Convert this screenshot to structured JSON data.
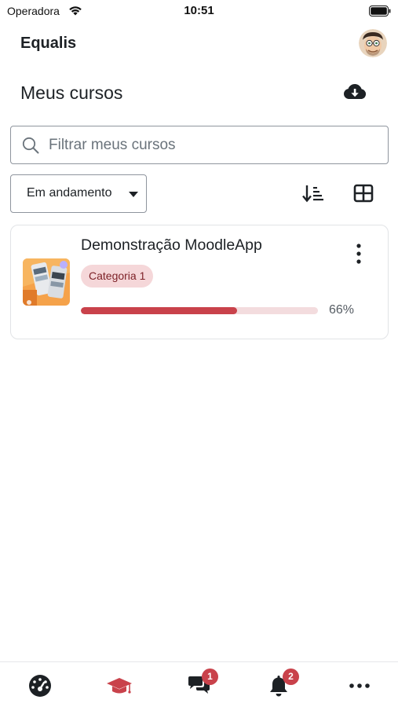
{
  "status_bar": {
    "carrier": "Operadora",
    "time": "10:51"
  },
  "header": {
    "app_title": "Equalis",
    "avatar_icon": "user-avatar"
  },
  "page": {
    "title": "Meus cursos",
    "download_icon": "cloud-download-icon"
  },
  "search": {
    "placeholder": "Filtrar meus cursos",
    "value": ""
  },
  "filter": {
    "selected": "Em andamento",
    "sort_icon": "sort-icon",
    "view_icon": "grid-view-icon"
  },
  "courses": [
    {
      "title": "Demonstração MoodleApp",
      "category": "Categoria 1",
      "progress": 66,
      "progress_text": "66%"
    }
  ],
  "tab_bar": {
    "tabs": [
      {
        "icon": "dashboard-icon",
        "badge": ""
      },
      {
        "icon": "graduation-cap-icon",
        "badge": ""
      },
      {
        "icon": "messages-icon",
        "badge": "1"
      },
      {
        "icon": "bell-icon",
        "badge": "2"
      },
      {
        "icon": "more-icon",
        "badge": ""
      }
    ]
  },
  "colors": {
    "accent": "#c9424b",
    "badge_bg": "#f5d7d9",
    "progress_track": "#f3dcde"
  }
}
